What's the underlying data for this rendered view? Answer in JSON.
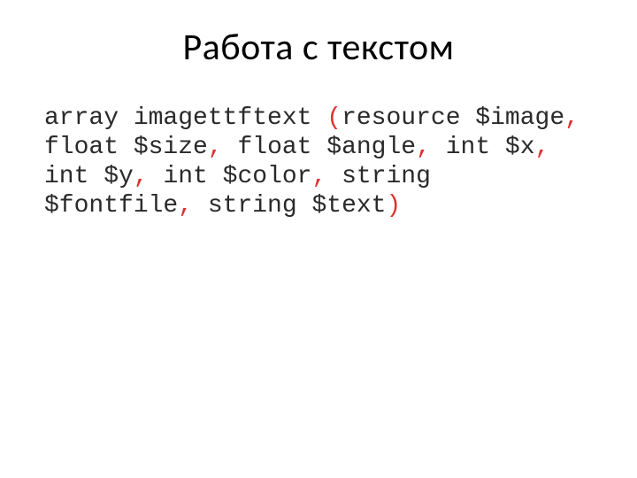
{
  "title": "Работа с текстом",
  "code": {
    "t1": "array imagettftext ",
    "p1": "(",
    "t2": "resource $image",
    "p2": ",",
    "t3": " float $size",
    "p3": ",",
    "t4": " float $angle",
    "p4": ",",
    "t5": " int $x",
    "p5": ",",
    "t6": " int $y",
    "p6": ",",
    "t7": " int $color",
    "p7": ",",
    "t8": " string $fontfile",
    "p8": ",",
    "t9": " string $text",
    "p9": ")"
  }
}
